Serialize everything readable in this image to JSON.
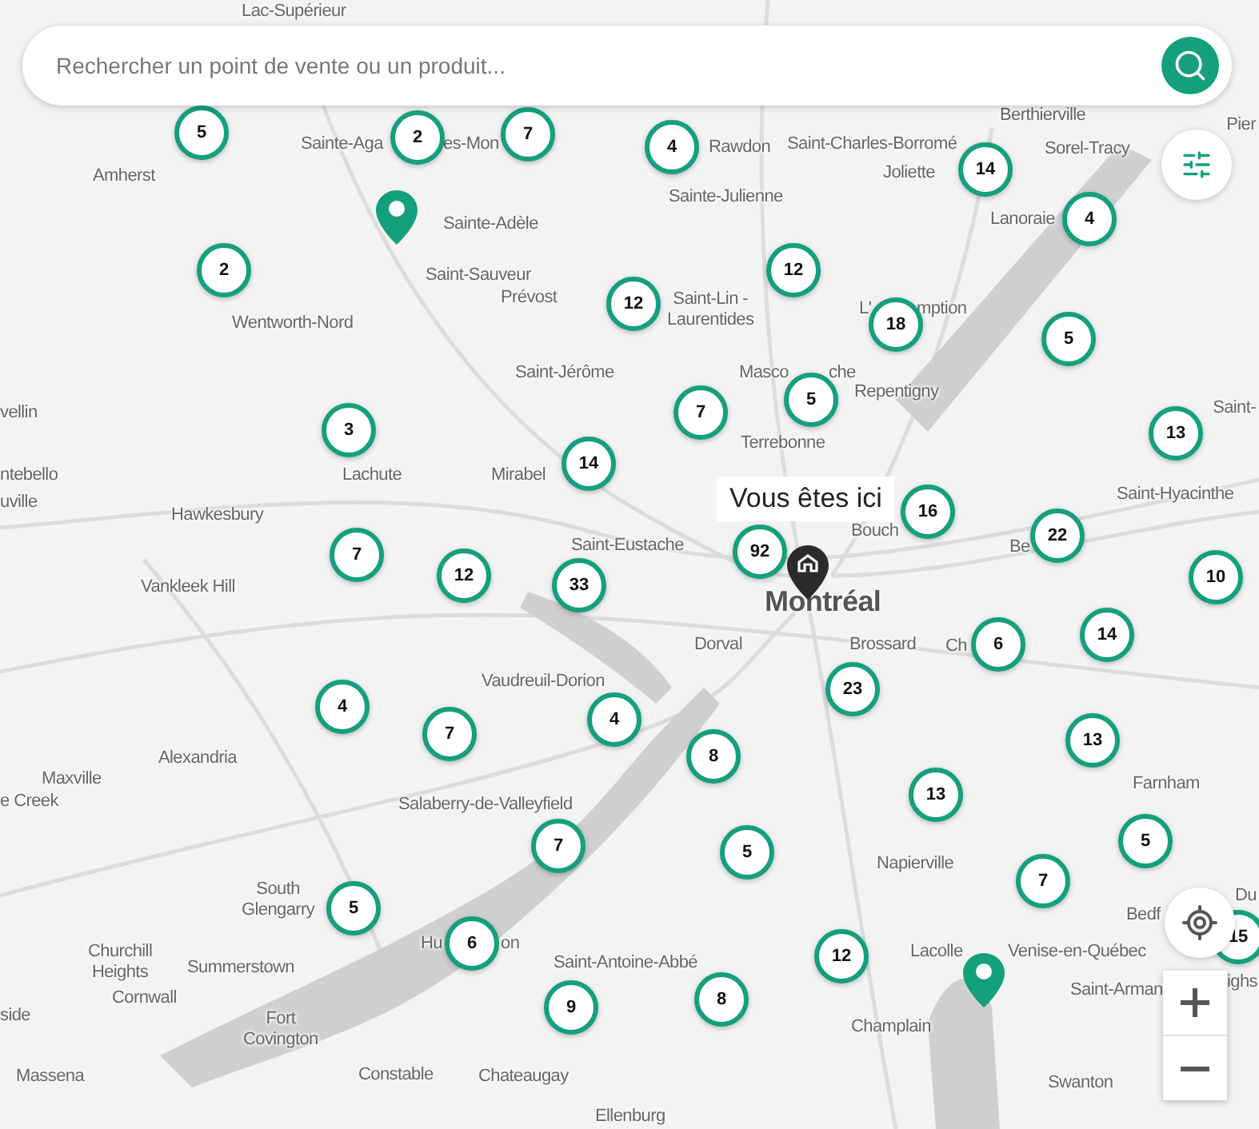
{
  "search": {
    "placeholder": "Rechercher un point de vente ou un produit..."
  },
  "tooltip": {
    "text": "Vous êtes ici"
  },
  "places": [
    {
      "name": "Lac-Supérieur",
      "kind": "town"
    },
    {
      "name": "Amherst",
      "kind": "town"
    },
    {
      "name": "Sainte-Aga",
      "kind": "town"
    },
    {
      "name": "es-Mon",
      "kind": "town"
    },
    {
      "name": "Sainte-Adèle",
      "kind": "town"
    },
    {
      "name": "Saint-Sauveur",
      "kind": "town"
    },
    {
      "name": "Prévost",
      "kind": "town"
    },
    {
      "name": "Wentworth-Nord",
      "kind": "town"
    },
    {
      "name": "Saint-Jérôme",
      "kind": "town"
    },
    {
      "name": "Lachute",
      "kind": "town"
    },
    {
      "name": "Mirabel",
      "kind": "town"
    },
    {
      "name": "Hawkesbury",
      "kind": "town"
    },
    {
      "name": "vellin",
      "kind": "town"
    },
    {
      "name": "ntebello",
      "kind": "town"
    },
    {
      "name": "uville",
      "kind": "town"
    },
    {
      "name": "Rawdon",
      "kind": "town"
    },
    {
      "name": "Saint-Charles-Borromé",
      "kind": "town"
    },
    {
      "name": "Joliette",
      "kind": "town"
    },
    {
      "name": "Sainte-Julienne",
      "kind": "town"
    },
    {
      "name": "Berthierville",
      "kind": "town"
    },
    {
      "name": "Sorel-Tracy",
      "kind": "town"
    },
    {
      "name": "Pier",
      "kind": "town"
    },
    {
      "name": "Lanoraie",
      "kind": "town"
    },
    {
      "name": "Saint-Lin -\nLaurentides",
      "kind": "town"
    },
    {
      "name": "L'",
      "kind": "town"
    },
    {
      "name": "mption",
      "kind": "town"
    },
    {
      "name": "Masco",
      "kind": "town"
    },
    {
      "name": "che",
      "kind": "town"
    },
    {
      "name": "Repentigny",
      "kind": "town"
    },
    {
      "name": "Terrebonne",
      "kind": "town"
    },
    {
      "name": "Saint-",
      "kind": "town"
    },
    {
      "name": "Saint-Hyacinthe",
      "kind": "town"
    },
    {
      "name": "Bouch",
      "kind": "town"
    },
    {
      "name": "Be",
      "kind": "town"
    },
    {
      "name": "Saint-Eustache",
      "kind": "town"
    },
    {
      "name": "Montréal",
      "kind": "city"
    },
    {
      "name": "Vankleek Hill",
      "kind": "town"
    },
    {
      "name": "Dorval",
      "kind": "town"
    },
    {
      "name": "Brossard",
      "kind": "town"
    },
    {
      "name": "Ch",
      "kind": "town"
    },
    {
      "name": "Vaudreuil-Dorion",
      "kind": "town"
    },
    {
      "name": "Alexandria",
      "kind": "town"
    },
    {
      "name": "Maxville",
      "kind": "town"
    },
    {
      "name": "e Creek",
      "kind": "town"
    },
    {
      "name": "Farnham",
      "kind": "town"
    },
    {
      "name": "Salaberry-de-Valleyfield",
      "kind": "town"
    },
    {
      "name": "Napierville",
      "kind": "town"
    },
    {
      "name": "South\nGlengarry",
      "kind": "town"
    },
    {
      "name": "Bedf",
      "kind": "town"
    },
    {
      "name": "Du",
      "kind": "town"
    },
    {
      "name": "Churchill\nHeights",
      "kind": "town"
    },
    {
      "name": "Hu",
      "kind": "town"
    },
    {
      "name": "on",
      "kind": "town"
    },
    {
      "name": "Lacolle",
      "kind": "town"
    },
    {
      "name": "Venise-en-Québec",
      "kind": "town"
    },
    {
      "name": "Summerstown",
      "kind": "town"
    },
    {
      "name": "Saint-Antoine-Abbé",
      "kind": "town"
    },
    {
      "name": "ighs",
      "kind": "town"
    },
    {
      "name": "Saint-Arman",
      "kind": "town"
    },
    {
      "name": "Cornwall",
      "kind": "town"
    },
    {
      "name": "side",
      "kind": "town"
    },
    {
      "name": "Fort\nCovington",
      "kind": "town"
    },
    {
      "name": "Champlain",
      "kind": "town"
    },
    {
      "name": "Massena",
      "kind": "town"
    },
    {
      "name": "Constable",
      "kind": "town"
    },
    {
      "name": "Chateaugay",
      "kind": "town"
    },
    {
      "name": "Swanton",
      "kind": "town"
    },
    {
      "name": "Ellenburg",
      "kind": "town"
    }
  ],
  "clusters": [
    {
      "count": "5"
    },
    {
      "count": "2"
    },
    {
      "count": "7"
    },
    {
      "count": "4"
    },
    {
      "count": "14"
    },
    {
      "count": "4"
    },
    {
      "count": "2"
    },
    {
      "count": "12"
    },
    {
      "count": "12"
    },
    {
      "count": "18"
    },
    {
      "count": "5"
    },
    {
      "count": "7"
    },
    {
      "count": "5"
    },
    {
      "count": "3"
    },
    {
      "count": "13"
    },
    {
      "count": "14"
    },
    {
      "count": "16"
    },
    {
      "count": "22"
    },
    {
      "count": "7"
    },
    {
      "count": "12"
    },
    {
      "count": "33"
    },
    {
      "count": "92"
    },
    {
      "count": "10"
    },
    {
      "count": "6"
    },
    {
      "count": "14"
    },
    {
      "count": "23"
    },
    {
      "count": "4"
    },
    {
      "count": "4"
    },
    {
      "count": "7"
    },
    {
      "count": "8"
    },
    {
      "count": "13"
    },
    {
      "count": "13"
    },
    {
      "count": "5"
    },
    {
      "count": "7"
    },
    {
      "count": "5"
    },
    {
      "count": "7"
    },
    {
      "count": "5"
    },
    {
      "count": "6"
    },
    {
      "count": "15"
    },
    {
      "count": "12"
    },
    {
      "count": "8"
    },
    {
      "count": "9"
    }
  ]
}
